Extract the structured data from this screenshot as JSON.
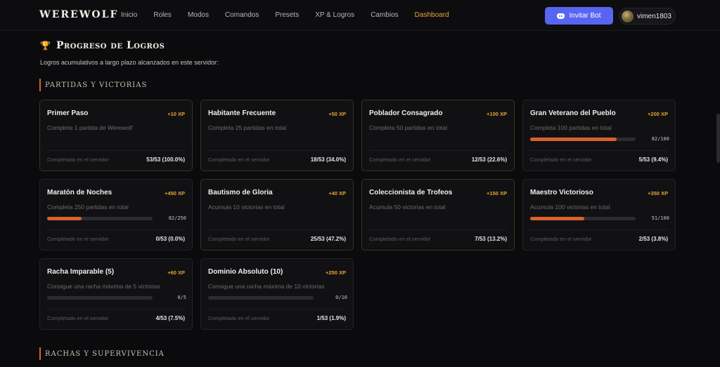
{
  "nav": {
    "brand": "WEREWOLF",
    "links": [
      {
        "label": "Inicio",
        "active": false
      },
      {
        "label": "Roles",
        "active": false
      },
      {
        "label": "Modos",
        "active": false
      },
      {
        "label": "Comandos",
        "active": false
      },
      {
        "label": "Presets",
        "active": false
      },
      {
        "label": "XP & Logros",
        "active": false
      },
      {
        "label": "Cambios",
        "active": false
      },
      {
        "label": "Dashboard",
        "active": true
      }
    ],
    "invite_label": "Invitar Bot",
    "username": "vimen1803"
  },
  "colors": {
    "accent": "#e8a530",
    "progress": "#d9622b",
    "discord": "#5865f2"
  },
  "page": {
    "title": "Progreso de Logros",
    "subtitle": "Logros acumulativos a largo plazo alcanzados en este servidor:"
  },
  "sections": [
    {
      "label": "Partidas y victorias"
    },
    {
      "label": "Rachas y supervivencia"
    }
  ],
  "cards": [
    {
      "name": "Primer Paso",
      "xp": "+10 XP",
      "desc": "Completa 1 partida de Werewolf",
      "server_label": "Completado en el servidor",
      "stat": "53/53 (100.0%)",
      "done": true
    },
    {
      "name": "Habitante Frecuente",
      "xp": "+50 XP",
      "desc": "Completa 25 partidas en total",
      "server_label": "Completado en el servidor",
      "stat": "18/53 (34.0%)",
      "done": true
    },
    {
      "name": "Poblador Consagrado",
      "xp": "+100 XP",
      "desc": "Completa 50 partidas en total",
      "server_label": "Completado en el servidor",
      "stat": "12/53 (22.6%)",
      "done": true
    },
    {
      "name": "Gran Veterano del Pueblo",
      "xp": "+200 XP",
      "desc": "Completa 100 partidas en total",
      "progress": 0.82,
      "progress_text": "82/100",
      "server_label": "Completado en el servidor",
      "stat": "5/53 (9.4%)",
      "done": false
    },
    {
      "name": "Maratón de Noches",
      "xp": "+450 XP",
      "desc": "Completa 250 partidas en total",
      "progress": 0.328,
      "progress_text": "82/250",
      "server_label": "Completado en el servidor",
      "stat": "0/53 (0.0%)",
      "done": false
    },
    {
      "name": "Bautismo de Gloria",
      "xp": "+40 XP",
      "desc": "Acumula 10 victorias en total",
      "server_label": "Completado en el servidor",
      "stat": "25/53 (47.2%)",
      "done": true
    },
    {
      "name": "Coleccionista de Trofeos",
      "xp": "+150 XP",
      "desc": "Acumula 50 victorias en total",
      "server_label": "Completado en el servidor",
      "stat": "7/53 (13.2%)",
      "done": true
    },
    {
      "name": "Maestro Victorioso",
      "xp": "+350 XP",
      "desc": "Acumula 100 victorias en total",
      "progress": 0.51,
      "progress_text": "51/100",
      "server_label": "Completado en el servidor",
      "stat": "2/53 (3.8%)",
      "done": false
    },
    {
      "name": "Racha Imparable (5)",
      "xp": "+60 XP",
      "desc": "Consigue una racha máxima de 5 victorias",
      "progress": 0.0,
      "progress_text": "0/5",
      "server_label": "Completado en el servidor",
      "stat": "4/53 (7.5%)",
      "done": false
    },
    {
      "name": "Dominio Absoluto (10)",
      "xp": "+250 XP",
      "desc": "Consigue una racha máxima de 10 victorias",
      "progress": 0.0,
      "progress_text": "0/10",
      "server_label": "Completado en el servidor",
      "stat": "1/53 (1.9%)",
      "done": false
    }
  ]
}
